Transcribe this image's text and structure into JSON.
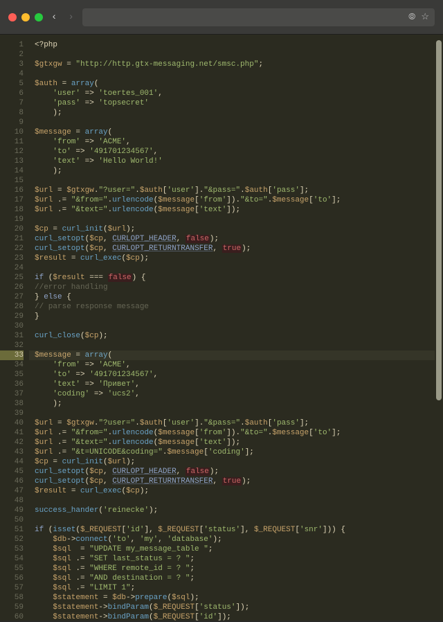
{
  "chrome": {
    "url": "",
    "back_icon": "‹",
    "fwd_icon": "›",
    "search_icon": "⦾",
    "star_icon": "☆"
  },
  "editor": {
    "highlighted_line": 33,
    "first_line": 1,
    "lines": [
      [
        [
          "op",
          "<?php"
        ]
      ],
      [],
      [
        [
          "var",
          "$gtxgw"
        ],
        [
          "op",
          " = "
        ],
        [
          "str",
          "\"http://http.gtx-messaging.net/smsc.php\""
        ],
        [
          "op",
          ";"
        ]
      ],
      [],
      [
        [
          "var",
          "$auth"
        ],
        [
          "op",
          " = "
        ],
        [
          "fn",
          "array"
        ],
        [
          "op",
          "("
        ]
      ],
      [
        [
          "op",
          "    "
        ],
        [
          "str",
          "'user'"
        ],
        [
          "op",
          " => "
        ],
        [
          "str",
          "'toertes_001'"
        ],
        [
          "op",
          ","
        ]
      ],
      [
        [
          "op",
          "    "
        ],
        [
          "str",
          "'pass'"
        ],
        [
          "op",
          " => "
        ],
        [
          "str",
          "'topsecret'"
        ]
      ],
      [
        [
          "op",
          "    );"
        ]
      ],
      [],
      [
        [
          "var",
          "$message"
        ],
        [
          "op",
          " = "
        ],
        [
          "fn",
          "array"
        ],
        [
          "op",
          "("
        ]
      ],
      [
        [
          "op",
          "    "
        ],
        [
          "str",
          "'from'"
        ],
        [
          "op",
          " => "
        ],
        [
          "str",
          "'ACME'"
        ],
        [
          "op",
          ","
        ]
      ],
      [
        [
          "op",
          "    "
        ],
        [
          "str",
          "'to'"
        ],
        [
          "op",
          " => "
        ],
        [
          "str",
          "'491701234567'"
        ],
        [
          "op",
          ","
        ]
      ],
      [
        [
          "op",
          "    "
        ],
        [
          "str",
          "'text'"
        ],
        [
          "op",
          " => "
        ],
        [
          "str",
          "'Hello World!'"
        ]
      ],
      [
        [
          "op",
          "    );"
        ]
      ],
      [],
      [
        [
          "var",
          "$url"
        ],
        [
          "op",
          " = "
        ],
        [
          "var",
          "$gtxgw"
        ],
        [
          "op",
          "."
        ],
        [
          "str",
          "\"?user=\""
        ],
        [
          "op",
          "."
        ],
        [
          "var",
          "$auth"
        ],
        [
          "op",
          "["
        ],
        [
          "str",
          "'user'"
        ],
        [
          "op",
          "]."
        ],
        [
          "str",
          "\"&pass=\""
        ],
        [
          "op",
          "."
        ],
        [
          "var",
          "$auth"
        ],
        [
          "op",
          "["
        ],
        [
          "str",
          "'pass'"
        ],
        [
          "op",
          "];"
        ]
      ],
      [
        [
          "var",
          "$url"
        ],
        [
          "op",
          " .= "
        ],
        [
          "str",
          "\"&from=\""
        ],
        [
          "op",
          "."
        ],
        [
          "fn",
          "urlencode"
        ],
        [
          "op",
          "("
        ],
        [
          "var",
          "$message"
        ],
        [
          "op",
          "["
        ],
        [
          "str",
          "'from'"
        ],
        [
          "op",
          "])."
        ],
        [
          "str",
          "\"&to=\""
        ],
        [
          "op",
          "."
        ],
        [
          "var",
          "$message"
        ],
        [
          "op",
          "["
        ],
        [
          "str",
          "'to'"
        ],
        [
          "op",
          "];"
        ]
      ],
      [
        [
          "var",
          "$url"
        ],
        [
          "op",
          " .= "
        ],
        [
          "str",
          "\"&text=\""
        ],
        [
          "op",
          "."
        ],
        [
          "fn",
          "urlencode"
        ],
        [
          "op",
          "("
        ],
        [
          "var",
          "$message"
        ],
        [
          "op",
          "["
        ],
        [
          "str",
          "'text'"
        ],
        [
          "op",
          "]);"
        ]
      ],
      [],
      [
        [
          "var",
          "$cp"
        ],
        [
          "op",
          " = "
        ],
        [
          "fn",
          "curl_init"
        ],
        [
          "op",
          "("
        ],
        [
          "var",
          "$url"
        ],
        [
          "op",
          ");"
        ]
      ],
      [
        [
          "fn",
          "curl_setopt"
        ],
        [
          "op",
          "("
        ],
        [
          "var",
          "$cp"
        ],
        [
          "op",
          ", "
        ],
        [
          "const",
          "CURLOPT_HEADER"
        ],
        [
          "op",
          ", "
        ],
        [
          "bool",
          "false"
        ],
        [
          "op",
          ");"
        ]
      ],
      [
        [
          "fn",
          "curl_setopt"
        ],
        [
          "op",
          "("
        ],
        [
          "var",
          "$cp"
        ],
        [
          "op",
          ", "
        ],
        [
          "const",
          "CURLOPT_RETURNTRANSFER"
        ],
        [
          "op",
          ", "
        ],
        [
          "bool",
          "true"
        ],
        [
          "op",
          ");"
        ]
      ],
      [
        [
          "var",
          "$result"
        ],
        [
          "op",
          " = "
        ],
        [
          "fn",
          "curl_exec"
        ],
        [
          "op",
          "("
        ],
        [
          "var",
          "$cp"
        ],
        [
          "op",
          ");"
        ]
      ],
      [],
      [
        [
          "kw",
          "if"
        ],
        [
          "op",
          " ("
        ],
        [
          "var",
          "$result"
        ],
        [
          "op",
          " === "
        ],
        [
          "bool",
          "false"
        ],
        [
          "op",
          ") {"
        ]
      ],
      [
        [
          "cmt",
          "//error handling"
        ]
      ],
      [
        [
          "op",
          "} "
        ],
        [
          "kw",
          "else"
        ],
        [
          "op",
          " {"
        ]
      ],
      [
        [
          "cmt",
          "// parse response message"
        ]
      ],
      [
        [
          "op",
          "}"
        ]
      ],
      [],
      [
        [
          "fn",
          "curl_close"
        ],
        [
          "op",
          "("
        ],
        [
          "var",
          "$cp"
        ],
        [
          "op",
          ");"
        ]
      ],
      [],
      [
        [
          "var",
          "$message"
        ],
        [
          "op",
          " = "
        ],
        [
          "fn",
          "array"
        ],
        [
          "op",
          "("
        ]
      ],
      [
        [
          "op",
          "    "
        ],
        [
          "str",
          "'from'"
        ],
        [
          "op",
          " => "
        ],
        [
          "str",
          "'ACME'"
        ],
        [
          "op",
          ","
        ]
      ],
      [
        [
          "op",
          "    "
        ],
        [
          "str",
          "'to'"
        ],
        [
          "op",
          " => "
        ],
        [
          "str",
          "'491701234567'"
        ],
        [
          "op",
          ","
        ]
      ],
      [
        [
          "op",
          "    "
        ],
        [
          "str",
          "'text'"
        ],
        [
          "op",
          " => "
        ],
        [
          "str",
          "'Привет'"
        ],
        [
          "op",
          ","
        ]
      ],
      [
        [
          "op",
          "    "
        ],
        [
          "str",
          "'coding'"
        ],
        [
          "op",
          " => "
        ],
        [
          "str",
          "'ucs2'"
        ],
        [
          "op",
          ","
        ]
      ],
      [
        [
          "op",
          "    );"
        ]
      ],
      [],
      [
        [
          "var",
          "$url"
        ],
        [
          "op",
          " = "
        ],
        [
          "var",
          "$gtxgw"
        ],
        [
          "op",
          "."
        ],
        [
          "str",
          "\"?user=\""
        ],
        [
          "op",
          "."
        ],
        [
          "var",
          "$auth"
        ],
        [
          "op",
          "["
        ],
        [
          "str",
          "'user'"
        ],
        [
          "op",
          "]."
        ],
        [
          "str",
          "\"&pass=\""
        ],
        [
          "op",
          "."
        ],
        [
          "var",
          "$auth"
        ],
        [
          "op",
          "["
        ],
        [
          "str",
          "'pass'"
        ],
        [
          "op",
          "];"
        ]
      ],
      [
        [
          "var",
          "$url"
        ],
        [
          "op",
          " .= "
        ],
        [
          "str",
          "\"&from=\""
        ],
        [
          "op",
          "."
        ],
        [
          "fn",
          "urlencode"
        ],
        [
          "op",
          "("
        ],
        [
          "var",
          "$message"
        ],
        [
          "op",
          "["
        ],
        [
          "str",
          "'from'"
        ],
        [
          "op",
          "])."
        ],
        [
          "str",
          "\"&to=\""
        ],
        [
          "op",
          "."
        ],
        [
          "var",
          "$message"
        ],
        [
          "op",
          "["
        ],
        [
          "str",
          "'to'"
        ],
        [
          "op",
          "];"
        ]
      ],
      [
        [
          "var",
          "$url"
        ],
        [
          "op",
          " .= "
        ],
        [
          "str",
          "\"&text=\""
        ],
        [
          "op",
          "."
        ],
        [
          "fn",
          "urlencode"
        ],
        [
          "op",
          "("
        ],
        [
          "var",
          "$message"
        ],
        [
          "op",
          "["
        ],
        [
          "str",
          "'text'"
        ],
        [
          "op",
          "]);"
        ]
      ],
      [
        [
          "var",
          "$url"
        ],
        [
          "op",
          " .= "
        ],
        [
          "str",
          "\"&t=UNICODE&coding=\""
        ],
        [
          "op",
          "."
        ],
        [
          "var",
          "$message"
        ],
        [
          "op",
          "["
        ],
        [
          "str",
          "'coding'"
        ],
        [
          "op",
          "];"
        ]
      ],
      [
        [
          "var",
          "$cp"
        ],
        [
          "op",
          " = "
        ],
        [
          "fn",
          "curl_init"
        ],
        [
          "op",
          "("
        ],
        [
          "var",
          "$url"
        ],
        [
          "op",
          ");"
        ]
      ],
      [
        [
          "fn",
          "curl_setopt"
        ],
        [
          "op",
          "("
        ],
        [
          "var",
          "$cp"
        ],
        [
          "op",
          ", "
        ],
        [
          "const",
          "CURLOPT_HEADER"
        ],
        [
          "op",
          ", "
        ],
        [
          "bool",
          "false"
        ],
        [
          "op",
          ");"
        ]
      ],
      [
        [
          "fn",
          "curl_setopt"
        ],
        [
          "op",
          "("
        ],
        [
          "var",
          "$cp"
        ],
        [
          "op",
          ", "
        ],
        [
          "const",
          "CURLOPT_RETURNTRANSFER"
        ],
        [
          "op",
          ", "
        ],
        [
          "bool",
          "true"
        ],
        [
          "op",
          ");"
        ]
      ],
      [
        [
          "var",
          "$result"
        ],
        [
          "op",
          " = "
        ],
        [
          "fn",
          "curl_exec"
        ],
        [
          "op",
          "("
        ],
        [
          "var",
          "$cp"
        ],
        [
          "op",
          ");"
        ]
      ],
      [],
      [
        [
          "fn",
          "success_hander"
        ],
        [
          "op",
          "("
        ],
        [
          "str",
          "'reinecke'"
        ],
        [
          "op",
          ");"
        ]
      ],
      [],
      [
        [
          "kw",
          "if"
        ],
        [
          "op",
          " ("
        ],
        [
          "fn",
          "isset"
        ],
        [
          "op",
          "("
        ],
        [
          "var",
          "$_REQUEST"
        ],
        [
          "op",
          "["
        ],
        [
          "str",
          "'id'"
        ],
        [
          "op",
          "], "
        ],
        [
          "var",
          "$_REQUEST"
        ],
        [
          "op",
          "["
        ],
        [
          "str",
          "'status'"
        ],
        [
          "op",
          "], "
        ],
        [
          "var",
          "$_REQUEST"
        ],
        [
          "op",
          "["
        ],
        [
          "str",
          "'snr'"
        ],
        [
          "op",
          "])) {"
        ]
      ],
      [
        [
          "op",
          "    "
        ],
        [
          "var",
          "$db"
        ],
        [
          "op",
          "->"
        ],
        [
          "fn",
          "connect"
        ],
        [
          "op",
          "("
        ],
        [
          "str",
          "'to'"
        ],
        [
          "op",
          ", "
        ],
        [
          "str",
          "'my'"
        ],
        [
          "op",
          ", "
        ],
        [
          "str",
          "'database'"
        ],
        [
          "op",
          ");"
        ]
      ],
      [
        [
          "op",
          "    "
        ],
        [
          "var",
          "$sql"
        ],
        [
          "op",
          "  = "
        ],
        [
          "str",
          "\"UPDATE my_message_table \""
        ],
        [
          "op",
          ";"
        ]
      ],
      [
        [
          "op",
          "    "
        ],
        [
          "var",
          "$sql"
        ],
        [
          "op",
          " .= "
        ],
        [
          "str",
          "\"SET last_status = ? \""
        ],
        [
          "op",
          ";"
        ]
      ],
      [
        [
          "op",
          "    "
        ],
        [
          "var",
          "$sql"
        ],
        [
          "op",
          " .= "
        ],
        [
          "str",
          "\"WHERE remote_id = ? \""
        ],
        [
          "op",
          ";"
        ]
      ],
      [
        [
          "op",
          "    "
        ],
        [
          "var",
          "$sql"
        ],
        [
          "op",
          " .= "
        ],
        [
          "str",
          "\"AND destination = ? \""
        ],
        [
          "op",
          ";"
        ]
      ],
      [
        [
          "op",
          "    "
        ],
        [
          "var",
          "$sql"
        ],
        [
          "op",
          " .= "
        ],
        [
          "str",
          "\"LIMIT 1\""
        ],
        [
          "op",
          ";"
        ]
      ],
      [
        [
          "op",
          "    "
        ],
        [
          "var",
          "$statement"
        ],
        [
          "op",
          " = "
        ],
        [
          "var",
          "$db"
        ],
        [
          "op",
          "->"
        ],
        [
          "fn",
          "prepare"
        ],
        [
          "op",
          "("
        ],
        [
          "var",
          "$sql"
        ],
        [
          "op",
          ");"
        ]
      ],
      [
        [
          "op",
          "    "
        ],
        [
          "var",
          "$statement"
        ],
        [
          "op",
          "->"
        ],
        [
          "fn",
          "bindParam"
        ],
        [
          "op",
          "("
        ],
        [
          "var",
          "$_REQUEST"
        ],
        [
          "op",
          "["
        ],
        [
          "str",
          "'status'"
        ],
        [
          "op",
          "]);"
        ]
      ],
      [
        [
          "op",
          "    "
        ],
        [
          "var",
          "$statement"
        ],
        [
          "op",
          "->"
        ],
        [
          "fn",
          "bindParam"
        ],
        [
          "op",
          "("
        ],
        [
          "var",
          "$_REQUEST"
        ],
        [
          "op",
          "["
        ],
        [
          "str",
          "'id'"
        ],
        [
          "op",
          "]);"
        ]
      ]
    ]
  }
}
